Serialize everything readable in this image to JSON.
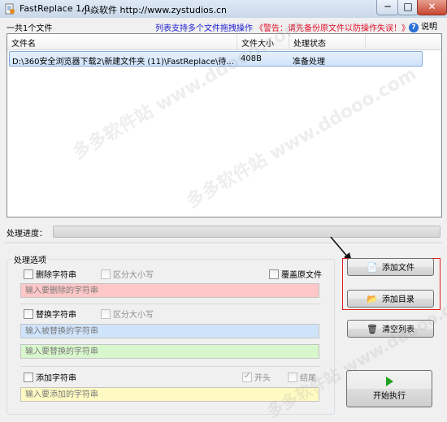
{
  "window": {
    "title": "FastReplace 1.0",
    "subtitle": "小焱软件 http://www.zystudios.cn",
    "minimize": "─",
    "maximize": "□",
    "close": "✕"
  },
  "header": {
    "file_count": "一共1个文件",
    "notice": "列表支持多个文件拖拽操作",
    "warning": "《警告：请先备份原文件以防操作失误！》",
    "help_label": "说明",
    "help_icon": "?"
  },
  "file_list": {
    "columns": [
      "文件名",
      "文件大小",
      "处理状态"
    ],
    "rows": [
      {
        "name": "D:\\360安全浏览器下载2\\新建文件夹 (11)\\FastReplace\\待...",
        "size": "408B",
        "status": "准备处理"
      }
    ]
  },
  "progress": {
    "label": "处理进度：",
    "value": 0
  },
  "options": {
    "group_title": "处理选项",
    "delete": {
      "label": "删除字符串",
      "case_label": "区分大小写",
      "overwrite_label": "覆盖原文件",
      "placeholder": "输入要删除的字符串"
    },
    "replace": {
      "label": "替换字符串",
      "case_label": "区分大小写",
      "find_placeholder": "输入被替换的字符串",
      "with_placeholder": "输入要替换的字符串"
    },
    "add": {
      "label": "添加字符串",
      "start_label": "开头",
      "end_label": "结尾",
      "placeholder": "输入要添加的字符串"
    }
  },
  "buttons": {
    "add_file": "添加文件",
    "add_folder": "添加目录",
    "clear_list": "清空列表",
    "start": "开始执行"
  },
  "watermark": "多多软件站 www.ddooo.com",
  "colors": {
    "notice": "#2020d0",
    "warning": "#e0102a",
    "highlight_box": "#e41c1c",
    "delete_field": "#ffc7c7",
    "replace_find_field": "#cfe3fb",
    "replace_with_field": "#d8f7cc",
    "add_field": "#fffac2"
  }
}
